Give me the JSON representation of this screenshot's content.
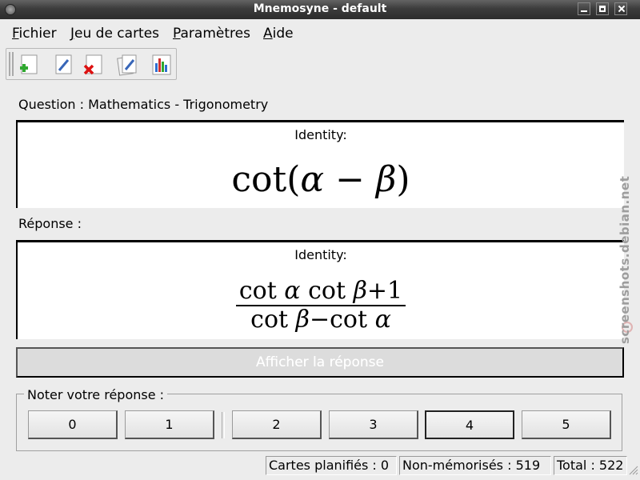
{
  "window": {
    "title": "Mnemosyne - default"
  },
  "menu": {
    "items": [
      {
        "first": "F",
        "rest": "ichier"
      },
      {
        "first": "J",
        "rest": "eu de cartes"
      },
      {
        "first": "P",
        "rest": "aramètres"
      },
      {
        "first": "A",
        "rest": "ide"
      }
    ]
  },
  "toolbar": {
    "icons": [
      "add-card-icon",
      "edit-card-icon",
      "delete-card-icon",
      "edit-deck-icon",
      "statistics-icon"
    ]
  },
  "question": {
    "label": "Question : Mathematics - Trigonometry",
    "heading": "Identity:",
    "formula": {
      "fn": "cot",
      "open": "(",
      "a": "α",
      "minus": " − ",
      "b": "β",
      "close": ")"
    }
  },
  "answer": {
    "label": "Réponse :",
    "heading": "Identity:",
    "numerator": {
      "t1": "cot",
      "v1": "α",
      "t2": " cot",
      "v2": "β",
      "tail": "+1"
    },
    "denominator": {
      "t1": "cot",
      "v1": "β",
      "t2": "−cot",
      "v2": "α"
    }
  },
  "show_answer_label": "Afficher la réponse",
  "grading": {
    "legend": "Noter votre réponse :",
    "buttons": [
      "0",
      "1",
      "2",
      "3",
      "4",
      "5"
    ]
  },
  "status": {
    "scheduled": "Cartes planifiés : 0",
    "not_memorised": "Non-mémorisés : 519",
    "total": "Total : 522"
  },
  "watermark": "screenshots.debian.net",
  "colors": {
    "titlebar": "#3c3c3c",
    "background": "#ececec",
    "panel": "#ffffff"
  }
}
